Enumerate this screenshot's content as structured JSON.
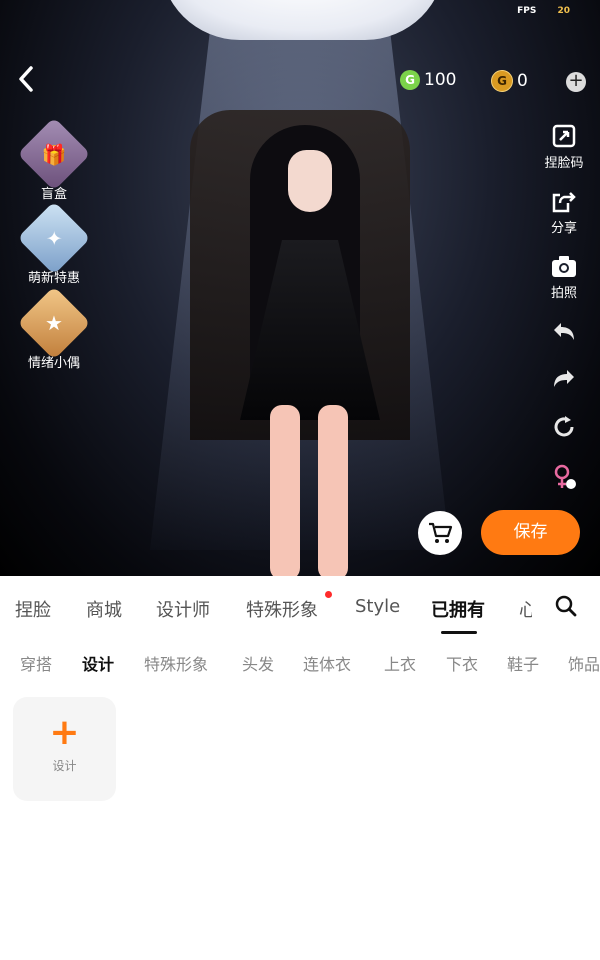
{
  "status": {
    "fps_label": "FPS",
    "fps_value": "20"
  },
  "currency": {
    "green_icon": "G",
    "green_amount": "100",
    "gold_icon": "G",
    "gold_amount": "0"
  },
  "left_menu": [
    {
      "label": "盲盒",
      "icon": "gift-box-icon",
      "glyph": "🎁"
    },
    {
      "label": "萌新特惠",
      "icon": "newbie-offer-icon",
      "glyph": "✦"
    },
    {
      "label": "情绪小偶",
      "icon": "emotion-doll-icon",
      "glyph": "★"
    }
  ],
  "right_menu": [
    {
      "label": "捏脸码",
      "icon": "face-code-icon"
    },
    {
      "label": "分享",
      "icon": "share-icon"
    },
    {
      "label": "拍照",
      "icon": "camera-icon"
    }
  ],
  "save_label": "保存",
  "tabs": [
    "捏脸",
    "商城",
    "设计师",
    "特殊形象",
    "Style",
    "已拥有",
    "心"
  ],
  "subtabs": [
    "穿搭",
    "设计",
    "特殊形象",
    "头发",
    "连体衣",
    "上衣",
    "下衣",
    "鞋子",
    "饰品"
  ],
  "design_card": {
    "plus": "+",
    "label": "设计"
  },
  "colors": {
    "accent": "#ff7a12",
    "tab_dot": "#ff2b2b"
  }
}
